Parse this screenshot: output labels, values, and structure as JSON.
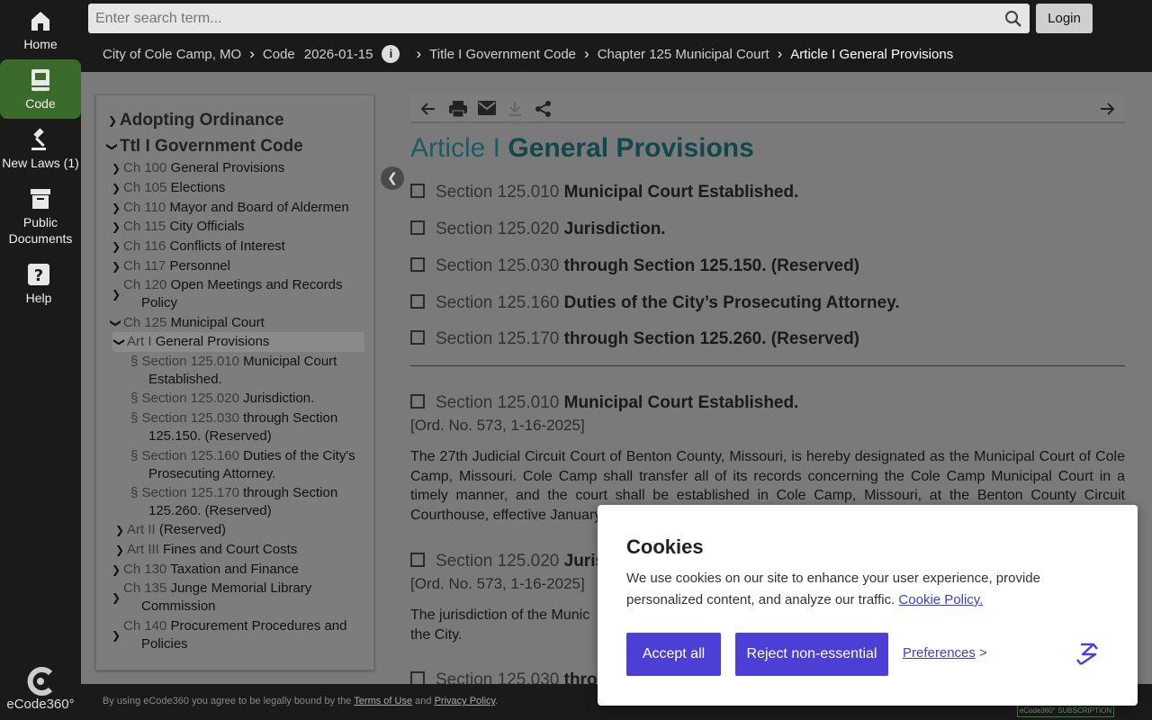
{
  "rail": {
    "home": "Home",
    "code": "Code",
    "new_laws": "New Laws (1)",
    "public_docs_1": "Public",
    "public_docs_2": "Documents",
    "help": "Help",
    "logo": "eCode360°"
  },
  "search": {
    "placeholder": "Enter search term..."
  },
  "login": "Login",
  "breadcrumb": {
    "city": "City of Cole Camp, MO",
    "code": "Code",
    "date": "2026-01-15",
    "title": "Title I Government Code",
    "chapter": "Chapter 125 Municipal Court",
    "article": "Article I General Provisions"
  },
  "toc": {
    "adopting": "Adopting Ordinance",
    "ttl": "Ttl I Government Code",
    "items": [
      {
        "num": "Ch 100",
        "label": "General Provisions"
      },
      {
        "num": "Ch 105",
        "label": "Elections"
      },
      {
        "num": "Ch 110",
        "label": "Mayor and Board of Aldermen"
      },
      {
        "num": "Ch 115",
        "label": "City Officials"
      },
      {
        "num": "Ch 116",
        "label": "Conflicts of Interest"
      },
      {
        "num": "Ch 117",
        "label": "Personnel"
      },
      {
        "num": "Ch 120",
        "label": "Open Meetings and Records",
        "label2": "Policy"
      },
      {
        "num": "Ch 125",
        "label": "Municipal Court"
      },
      {
        "num": "Art I",
        "label": "General Provisions"
      },
      {
        "num": "§ Section 125.010",
        "label": "Municipal Court",
        "label2": "Established."
      },
      {
        "num": "§ Section 125.020",
        "label": "Jurisdiction."
      },
      {
        "num": "§ Section 125.030",
        "label": "through Section",
        "label2": "125.150. (Reserved)"
      },
      {
        "num": "§ Section 125.160",
        "label": "Duties of the City's",
        "label2": "Prosecuting Attorney."
      },
      {
        "num": "§ Section 125.170",
        "label": "through Section",
        "label2": "125.260. (Reserved)"
      },
      {
        "num": "Art II",
        "label": "(Reserved)"
      },
      {
        "num": "Art III",
        "label": "Fines and Court Costs"
      },
      {
        "num": "Ch 130",
        "label": "Taxation and Finance"
      },
      {
        "num": "Ch 135",
        "label": "Junge Memorial Library",
        "label2": "Commission"
      },
      {
        "num": "Ch 140",
        "label": "Procurement Procedures and",
        "label2": "Policies"
      }
    ]
  },
  "article": {
    "prefix": "Article I",
    "title": "General Provisions"
  },
  "sections": [
    {
      "num": "Section 125.010",
      "title": "Municipal Court Established."
    },
    {
      "num": "Section 125.020",
      "title": "Jurisdiction."
    },
    {
      "num": "Section 125.030",
      "title": "through Section 125.150. (Reserved)"
    },
    {
      "num": "Section 125.160",
      "title": "Duties of the City’s Prosecuting Attorney."
    },
    {
      "num": "Section 125.170",
      "title": "through Section 125.260. (Reserved)"
    }
  ],
  "body": {
    "s1_num": "Section 125.010",
    "s1_title": "Municipal Court Established.",
    "s1_ord": "[Ord. No. 573, 1-16-2025]",
    "s1_text": "The 27th Judicial Circuit Court of Benton County, Missouri, is hereby designated as the Municipal Court of Cole Camp, Missouri. Cole Camp shall transfer all of its records concerning the Cole Camp Municipal Court in a timely manner, and the court shall be established in Cole Camp, Missouri, at the Benton County Circuit Courthouse, effective January",
    "s2_num": "Section 125.020",
    "s2_title": "Juris",
    "s2_ord": "[Ord. No. 573, 1-16-2025]",
    "s2_text1": "The jurisdiction of the Munic",
    "s2_text2": "the City.",
    "s3_partial": "Section 125.030",
    "s3_title": "throu"
  },
  "footer": {
    "pre": "By using eCode360 you agree to be legally bound by the",
    "terms": "Terms of Use",
    "and": "and",
    "privacy": "Privacy Policy",
    "period": ".",
    "badge": "eCode360° SUBSCRIPTION"
  },
  "cookie": {
    "title": "Cookies",
    "text": "We use cookies on our site to enhance your user experience, provide personalized content, and analyze our traffic.",
    "policy_link": "Cookie Policy.",
    "accept": "Accept all",
    "reject": "Reject non-essential",
    "preferences": "Preferences",
    "pref_arrow": ">"
  }
}
